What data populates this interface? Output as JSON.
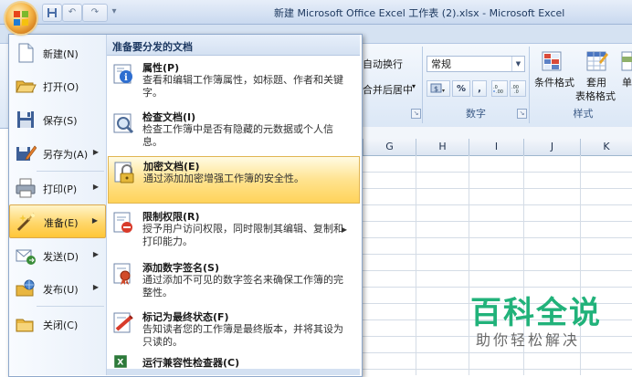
{
  "window": {
    "title": "新建 Microsoft Office Excel 工作表 (2).xlsx - Microsoft Excel"
  },
  "quick_access": {
    "undo": "↶",
    "redo": "↷",
    "customize": "▾"
  },
  "ribbon": {
    "wrap_text": "自动换行",
    "merge_center": "合并后居中",
    "number_format": "常规",
    "percent": "%",
    "comma": ",",
    "group_number": "数字",
    "conditional_format": "条件格式",
    "table_format_line1": "套用",
    "table_format_line2": "表格格式",
    "cell_styles": "单",
    "group_styles": "样式"
  },
  "sheet": {
    "columns": [
      "G",
      "H",
      "I",
      "J",
      "K"
    ]
  },
  "office_menu": {
    "left_items": [
      {
        "label": "新建(N)",
        "icon": "new-document-icon",
        "has_arrow": false
      },
      {
        "label": "打开(O)",
        "icon": "open-folder-icon",
        "has_arrow": false
      },
      {
        "label": "保存(S)",
        "icon": "save-disk-icon",
        "has_arrow": false
      },
      {
        "label": "另存为(A)",
        "icon": "save-as-icon",
        "has_arrow": true
      },
      {
        "label": "打印(P)",
        "icon": "printer-icon",
        "has_arrow": true
      },
      {
        "label": "准备(E)",
        "icon": "prepare-icon",
        "has_arrow": true
      },
      {
        "label": "发送(D)",
        "icon": "send-icon",
        "has_arrow": true
      },
      {
        "label": "发布(U)",
        "icon": "publish-icon",
        "has_arrow": true
      },
      {
        "label": "关闭(C)",
        "icon": "close-folder-icon",
        "has_arrow": false
      }
    ],
    "selected_left": "准备(E)",
    "panel_title": "准备要分发的文档",
    "panel_items": [
      {
        "title": "属性(P)",
        "desc": "查看和编辑工作簿属性，如标题、作者和关键字。",
        "icon": "properties-icon"
      },
      {
        "title": "检查文档(I)",
        "desc": "检查工作簿中是否有隐藏的元数据或个人信息。",
        "icon": "inspect-document-icon"
      },
      {
        "title": "加密文档(E)",
        "desc": "通过添加加密增强工作簿的安全性。",
        "icon": "encrypt-lock-icon"
      },
      {
        "title": "限制权限(R)",
        "desc": "授予用户访问权限，同时限制其编辑、复制和打印能力。",
        "icon": "restrict-permission-icon"
      },
      {
        "title": "添加数字签名(S)",
        "desc": "通过添加不可见的数字签名来确保工作簿的完整性。",
        "icon": "digital-signature-icon"
      },
      {
        "title": "标记为最终状态(F)",
        "desc": "告知读者您的工作簿是最终版本，并将其设为只读的。",
        "icon": "mark-final-icon"
      },
      {
        "title": "运行兼容性检查器(C)",
        "desc": "",
        "icon": "compatibility-checker-icon"
      }
    ],
    "selected_panel": "加密文档(E)"
  },
  "watermark": {
    "big": "百科全说",
    "small": "助你轻松解决"
  }
}
